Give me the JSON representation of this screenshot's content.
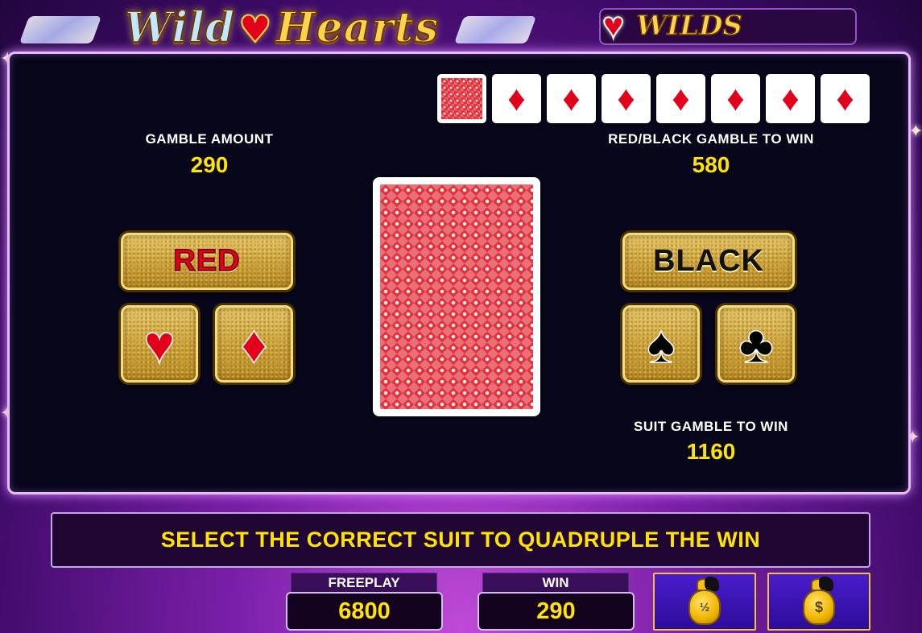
{
  "header": {
    "logo_word1": "Wild",
    "logo_word2": "Hearts",
    "wilds_label": "WILDS"
  },
  "history": {
    "cards": [
      {
        "type": "back",
        "icon": "card-back-icon"
      },
      {
        "type": "diamond",
        "symbol": "♦"
      },
      {
        "type": "diamond",
        "symbol": "♦"
      },
      {
        "type": "diamond",
        "symbol": "♦"
      },
      {
        "type": "diamond",
        "symbol": "♦"
      },
      {
        "type": "diamond",
        "symbol": "♦"
      },
      {
        "type": "diamond",
        "symbol": "♦"
      },
      {
        "type": "diamond",
        "symbol": "♦"
      }
    ]
  },
  "gamble": {
    "amount_label": "GAMBLE AMOUNT",
    "amount_value": "290",
    "redblack_label": "RED/BLACK GAMBLE TO WIN",
    "redblack_value": "580",
    "suit_label": "SUIT GAMBLE TO WIN",
    "suit_value": "1160"
  },
  "buttons": {
    "red": "RED",
    "black": "BLACK",
    "heart": "♥",
    "diamond": "♦",
    "spade": "♠",
    "club": "♣"
  },
  "message": "SELECT THE CORRECT SUIT TO QUADRUPLE THE WIN",
  "meters": {
    "freeplay_label": "FREEPLAY",
    "freeplay_value": "6800",
    "win_label": "WIN",
    "win_value": "290"
  },
  "collect": {
    "half_label": "½",
    "full_label": "$"
  },
  "colors": {
    "accent_gold": "#ffe400",
    "suit_red": "#e3001b",
    "panel_bg": "#07061a"
  }
}
